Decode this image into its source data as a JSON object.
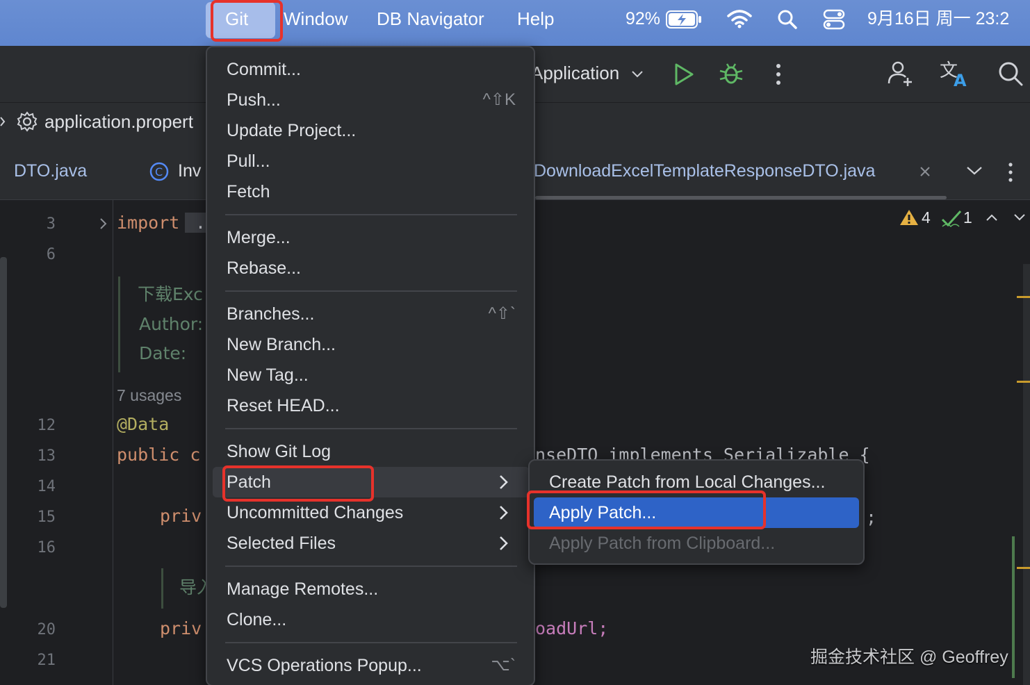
{
  "menubar": {
    "items": [
      "Git",
      "Window",
      "DB Navigator",
      "Help"
    ],
    "battery": "92%",
    "datetime": "9月16日 周一 23:2"
  },
  "toolbar": {
    "run_config": "Application"
  },
  "breadcrumb": {
    "file": "application.propert"
  },
  "tabs": [
    {
      "label": "DTO.java"
    },
    {
      "label": "Inv"
    },
    {
      "label": "DownloadExcelTemplateResponseDTO.java"
    }
  ],
  "inspections": {
    "warnings": "4",
    "ok": "1"
  },
  "editor": {
    "line_numbers": [
      "3",
      "6",
      "12",
      "13",
      "14",
      "15",
      "16",
      "20",
      "21"
    ],
    "import_kw": "import",
    "import_rest": " .",
    "doc_title": "下载Exc",
    "doc_author": "Author:",
    "doc_date": "Date:",
    "usages": "7 usages",
    "annotation": "@Data",
    "public_kw": "public c",
    "priv1": "priv",
    "doc2": "导入",
    "priv2": "priv",
    "class_tail": "nseDTO implements Serializable {",
    "semi": ";",
    "field_tail": "oadUrl;"
  },
  "git_menu": {
    "items": [
      {
        "label": "Commit..."
      },
      {
        "label": "Push...",
        "shortcut": "^⇧K"
      },
      {
        "label": "Update Project..."
      },
      {
        "label": "Pull..."
      },
      {
        "label": "Fetch"
      },
      {
        "label": "Merge..."
      },
      {
        "label": "Rebase..."
      },
      {
        "label": "Branches...",
        "shortcut": "^⇧`"
      },
      {
        "label": "New Branch..."
      },
      {
        "label": "New Tag..."
      },
      {
        "label": "Reset HEAD..."
      },
      {
        "label": "Show Git Log"
      },
      {
        "label": "Patch"
      },
      {
        "label": "Uncommitted Changes"
      },
      {
        "label": "Selected Files"
      },
      {
        "label": "Manage Remotes..."
      },
      {
        "label": "Clone..."
      },
      {
        "label": "VCS Operations Popup...",
        "shortcut": "⌥`"
      }
    ]
  },
  "patch_submenu": {
    "items": [
      {
        "label": "Create Patch from Local Changes..."
      },
      {
        "label": "Apply Patch..."
      },
      {
        "label": "Apply Patch from Clipboard..."
      }
    ]
  },
  "watermark": "掘金技术社区 @ Geoffrey",
  "colors": {
    "highlight_box": "#e6322b",
    "selected_item": "#2e63c7",
    "menubar_bg": "#6a8fd3"
  }
}
